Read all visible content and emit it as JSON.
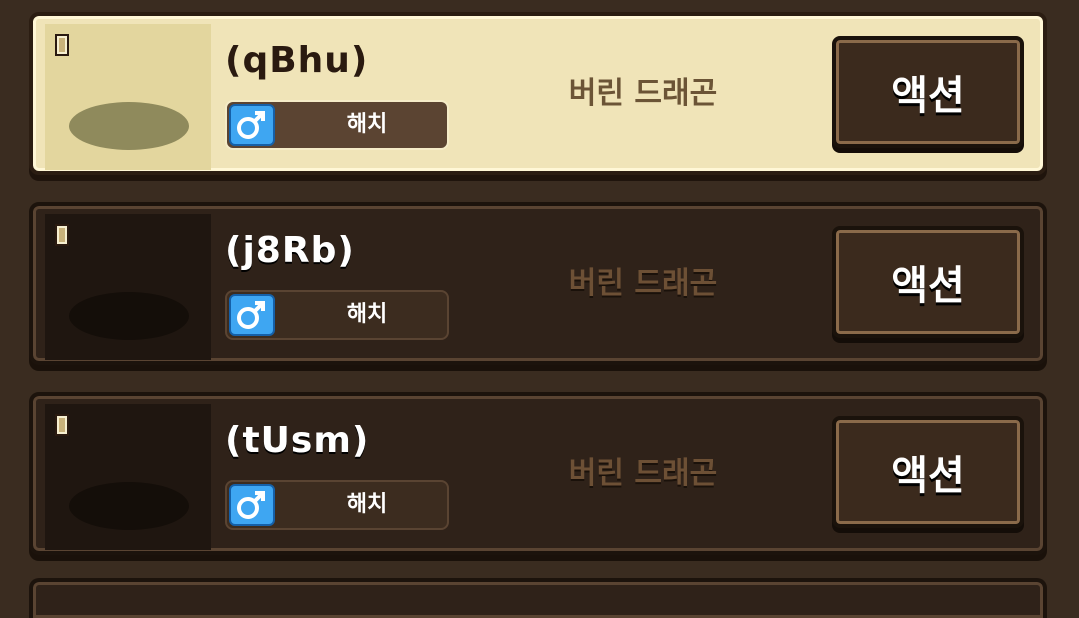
{
  "dragons": [
    {
      "name": "(qBhu)",
      "status": "해치",
      "type": "버린 드래곤",
      "action_label": "액션",
      "selected": true
    },
    {
      "name": "(j8Rb)",
      "status": "해치",
      "type": "버린 드래곤",
      "action_label": "액션",
      "selected": false
    },
    {
      "name": "(tUsm)",
      "status": "해치",
      "type": "버린 드래곤",
      "action_label": "액션",
      "selected": false
    }
  ],
  "icons": {
    "door": "door-icon",
    "gender": "male-gender-icon"
  },
  "colors": {
    "selected_card_bg": "#f0e4b8",
    "card_bg": "#2f2219",
    "male_icon": "#3ea6f2",
    "action_button_bg": "#3b2a1d"
  }
}
